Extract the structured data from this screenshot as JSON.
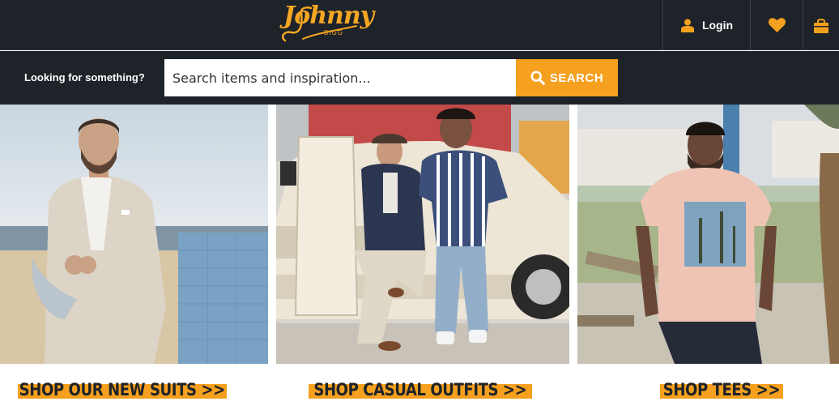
{
  "header": {
    "logo": {
      "word": "Johnny",
      "sub": "BIGG"
    },
    "login_label": "Login",
    "icons": {
      "user": "user-icon",
      "wishlist": "heart-icon",
      "bag": "shopping-bag-icon"
    },
    "colors": {
      "background": "#1e2329",
      "accent": "#f5a01e"
    }
  },
  "search": {
    "prompt": "Looking for something?",
    "placeholder": "Search items and inspiration...",
    "button_label": "SEARCH"
  },
  "tiles": [
    {
      "cta": "SHOP OUR NEW SUITS >>"
    },
    {
      "cta": "SHOP CASUAL OUTFITS >>"
    },
    {
      "cta": "SHOP TEES >>"
    }
  ]
}
